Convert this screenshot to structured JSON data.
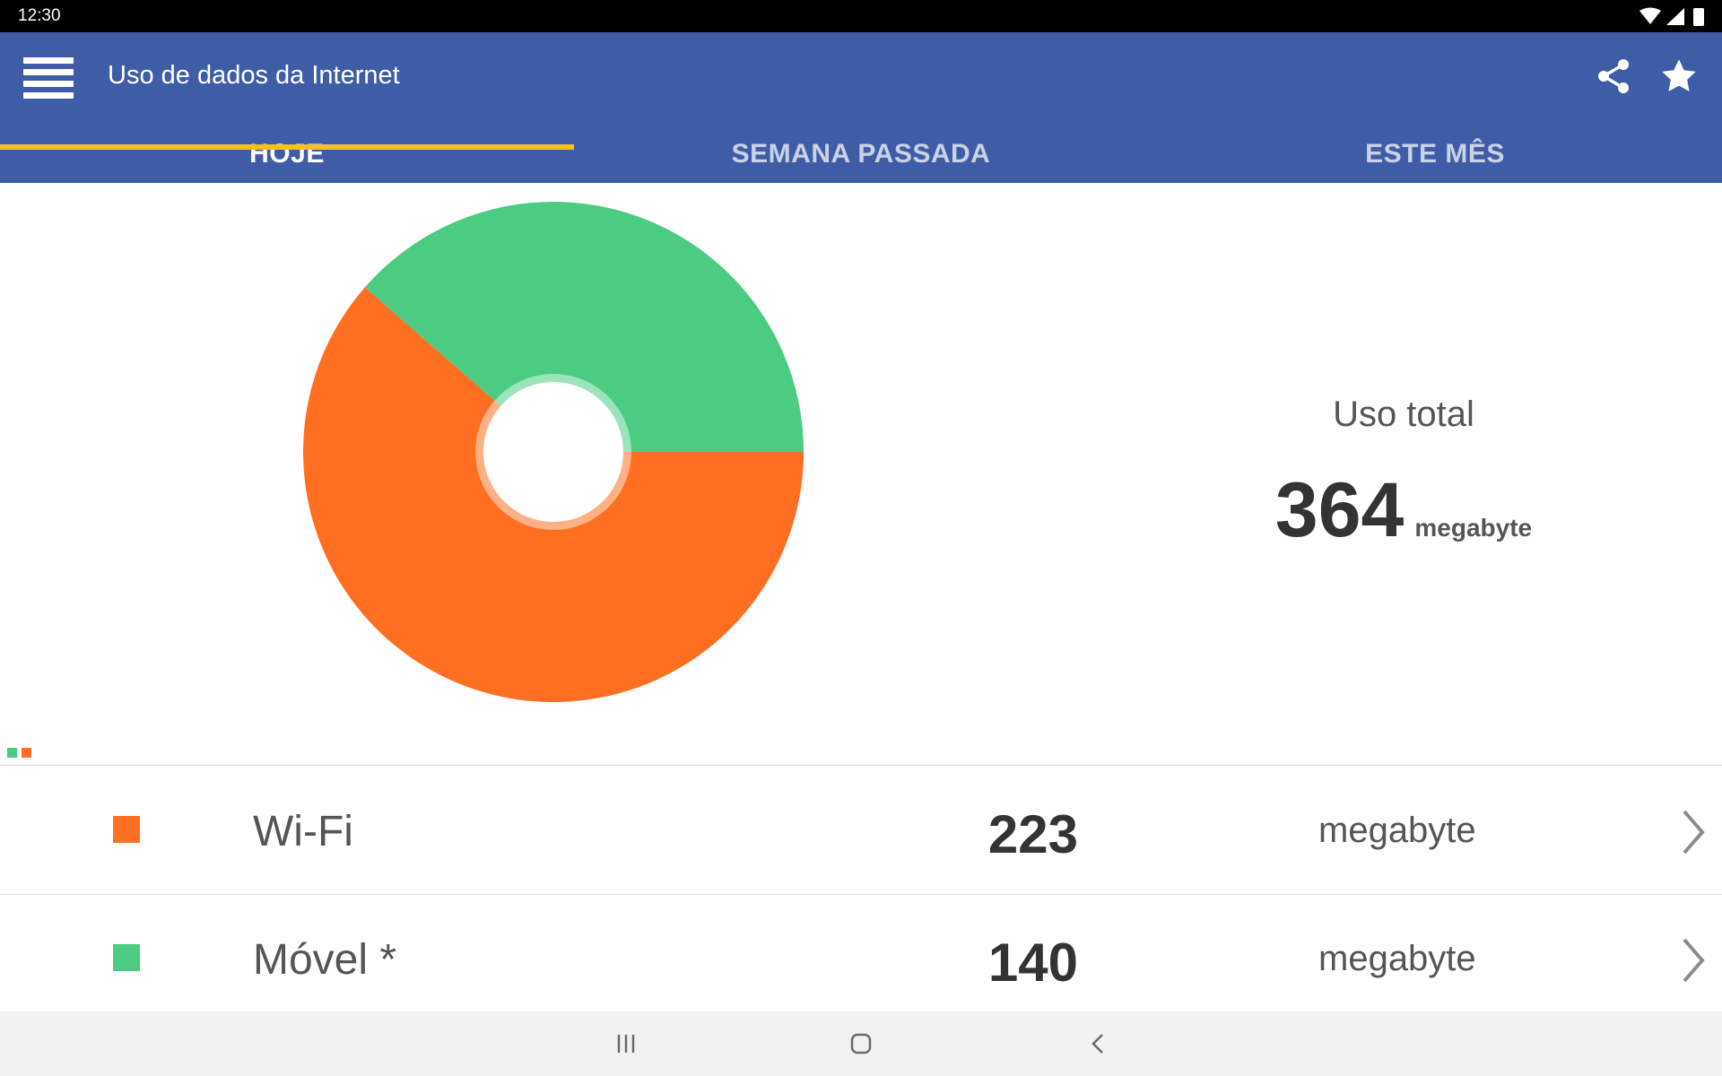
{
  "status_bar": {
    "time": "12:30"
  },
  "app_bar": {
    "title": "Uso de dados da Internet"
  },
  "tabs": [
    {
      "label": "HOJE",
      "active": true
    },
    {
      "label": "SEMANA PASSADA",
      "active": false
    },
    {
      "label": "ESTE MÊS",
      "active": false
    }
  ],
  "colors": {
    "primary": "#3f5da7",
    "tab_indicator": "#f5c11b",
    "wifi": "#ff6f21",
    "mobile": "#4ccb82"
  },
  "summary": {
    "label": "Uso total",
    "value": "364",
    "unit": "megabyte"
  },
  "usage_rows": [
    {
      "label": "Wi-Fi",
      "value": "223",
      "unit": "megabyte",
      "color": "#ff6f21"
    },
    {
      "label": "Móvel *",
      "value": "140",
      "unit": "megabyte",
      "color": "#4ccb82"
    }
  ],
  "chart_data": {
    "type": "pie",
    "categories": [
      "Wi-Fi",
      "Móvel *"
    ],
    "values": [
      223,
      140
    ],
    "colors": [
      "#ff6f21",
      "#4ccb82"
    ],
    "donut": true
  },
  "icons": {
    "menu": "menu-icon",
    "share": "share-icon",
    "favorite": "star-icon",
    "row_action": "chevron-right-icon"
  }
}
